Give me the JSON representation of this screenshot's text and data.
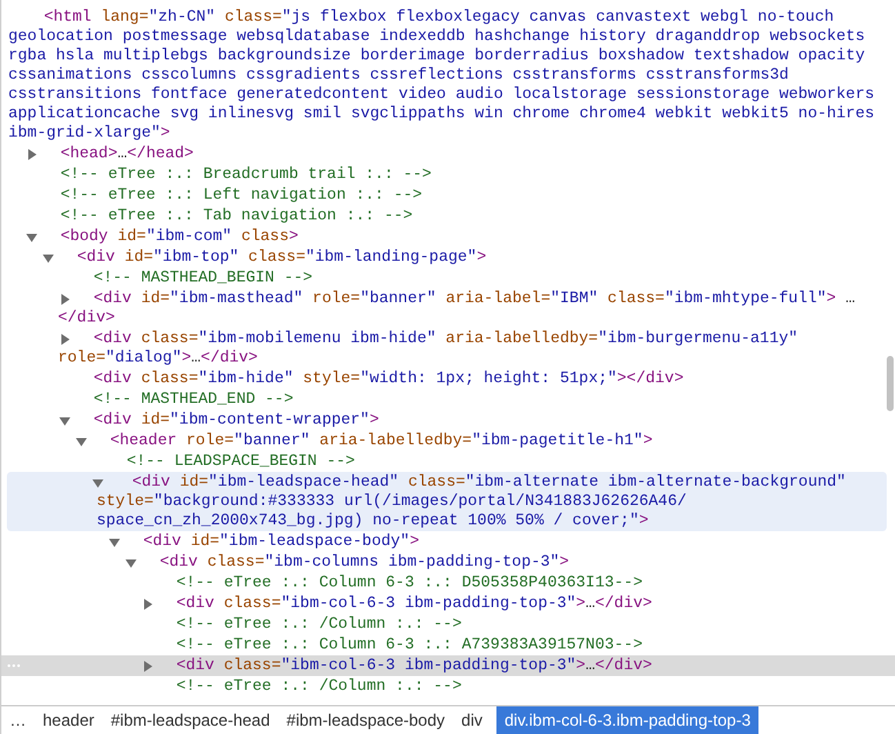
{
  "elements_tree": {
    "hovered": false,
    "selected": false,
    "tokens": [
      {
        "kind": "tag",
        "text": "<html"
      },
      {
        "kind": "attr",
        "text": " lang="
      },
      {
        "kind": "value",
        "text": "\"zh-CN\""
      },
      {
        "kind": "attr",
        "text": " class="
      },
      {
        "kind": "value",
        "text": "\"js flexbox flexboxlegacy canvas canvastext webgl no-touch geolocation postmessage websqldatabase indexeddb hashchange history draganddrop websockets rgba hsla multiplebgs backgroundsize borderimage borderradius boxshadow textshadow opacity cssanimations csscolumns cssgradients cssreflections csstransforms csstransforms3d csstransitions fontface generatedcontent video audio localstorage sessionstorage webworkers applicationcache svg inlinesvg smil svgclippaths win chrome chrome4 webkit webkit5 no-hires ibm-grid-xlarge\""
      },
      {
        "kind": "tag",
        "text": ">"
      }
    ],
    "children": [
      {
        "expanded": false,
        "hovered": false,
        "selected": false,
        "tokens": [
          {
            "kind": "tag",
            "text": "<head>"
          },
          {
            "kind": "text",
            "text": "…"
          },
          {
            "kind": "tag",
            "text": "</head>"
          }
        ]
      },
      {
        "hovered": false,
        "selected": false,
        "tokens": [
          {
            "kind": "comment",
            "text": "<!-- eTree :.: Breadcrumb trail :.: -->"
          }
        ]
      },
      {
        "hovered": false,
        "selected": false,
        "tokens": [
          {
            "kind": "comment",
            "text": "<!-- eTree :.: Left navigation :.: -->"
          }
        ]
      },
      {
        "hovered": false,
        "selected": false,
        "tokens": [
          {
            "kind": "comment",
            "text": "<!-- eTree :.: Tab navigation :.: -->"
          }
        ]
      },
      {
        "expanded": true,
        "hovered": false,
        "selected": false,
        "tokens": [
          {
            "kind": "tag",
            "text": "<body"
          },
          {
            "kind": "attr",
            "text": " id="
          },
          {
            "kind": "value",
            "text": "\"ibm-com\""
          },
          {
            "kind": "attr",
            "text": " class"
          },
          {
            "kind": "tag",
            "text": ">"
          }
        ],
        "children": [
          {
            "expanded": true,
            "hovered": false,
            "selected": false,
            "tokens": [
              {
                "kind": "tag",
                "text": "<div"
              },
              {
                "kind": "attr",
                "text": " id="
              },
              {
                "kind": "value",
                "text": "\"ibm-top\""
              },
              {
                "kind": "attr",
                "text": " class="
              },
              {
                "kind": "value",
                "text": "\"ibm-landing-page\""
              },
              {
                "kind": "tag",
                "text": ">"
              }
            ],
            "children": [
              {
                "hovered": false,
                "selected": false,
                "tokens": [
                  {
                    "kind": "comment",
                    "text": "<!-- MASTHEAD_BEGIN -->"
                  }
                ]
              },
              {
                "expanded": false,
                "hovered": false,
                "selected": false,
                "tokens": [
                  {
                    "kind": "tag",
                    "text": "<div"
                  },
                  {
                    "kind": "attr",
                    "text": " id="
                  },
                  {
                    "kind": "value",
                    "text": "\"ibm-masthead\""
                  },
                  {
                    "kind": "attr",
                    "text": " role="
                  },
                  {
                    "kind": "value",
                    "text": "\"banner\""
                  },
                  {
                    "kind": "attr",
                    "text": " aria-label="
                  },
                  {
                    "kind": "value",
                    "text": "\"IBM\""
                  },
                  {
                    "kind": "attr",
                    "text": " class="
                  },
                  {
                    "kind": "value",
                    "text": "\"ibm-mhtype-full\""
                  },
                  {
                    "kind": "tag",
                    "text": ">"
                  },
                  {
                    "kind": "text",
                    "text": " …"
                  },
                  {
                    "kind": "tag",
                    "text": "</div>"
                  }
                ]
              },
              {
                "expanded": false,
                "hovered": false,
                "selected": false,
                "tokens": [
                  {
                    "kind": "tag",
                    "text": "<div"
                  },
                  {
                    "kind": "attr",
                    "text": " class="
                  },
                  {
                    "kind": "value",
                    "text": "\"ibm-mobilemenu ibm-hide\""
                  },
                  {
                    "kind": "attr",
                    "text": " aria-labelledby="
                  },
                  {
                    "kind": "value",
                    "text": "\"ibm-burgermenu-a11y\""
                  },
                  {
                    "kind": "attr",
                    "text": " role="
                  },
                  {
                    "kind": "value",
                    "text": "\"dialog\""
                  },
                  {
                    "kind": "tag",
                    "text": ">"
                  },
                  {
                    "kind": "text",
                    "text": "…"
                  },
                  {
                    "kind": "tag",
                    "text": "</div>"
                  }
                ]
              },
              {
                "hovered": false,
                "selected": false,
                "tokens": [
                  {
                    "kind": "tag",
                    "text": "<div"
                  },
                  {
                    "kind": "attr",
                    "text": " class="
                  },
                  {
                    "kind": "value",
                    "text": "\"ibm-hide\""
                  },
                  {
                    "kind": "attr",
                    "text": " style="
                  },
                  {
                    "kind": "value",
                    "text": "\"width: 1px; height: 51px;\""
                  },
                  {
                    "kind": "tag",
                    "text": "></div>"
                  }
                ]
              },
              {
                "hovered": false,
                "selected": false,
                "tokens": [
                  {
                    "kind": "comment",
                    "text": "<!-- MASTHEAD_END -->"
                  }
                ]
              },
              {
                "expanded": true,
                "hovered": false,
                "selected": false,
                "tokens": [
                  {
                    "kind": "tag",
                    "text": "<div"
                  },
                  {
                    "kind": "attr",
                    "text": " id="
                  },
                  {
                    "kind": "value",
                    "text": "\"ibm-content-wrapper\""
                  },
                  {
                    "kind": "tag",
                    "text": ">"
                  }
                ],
                "children": [
                  {
                    "expanded": true,
                    "hovered": false,
                    "selected": false,
                    "tokens": [
                      {
                        "kind": "tag",
                        "text": "<header"
                      },
                      {
                        "kind": "attr",
                        "text": " role="
                      },
                      {
                        "kind": "value",
                        "text": "\"banner\""
                      },
                      {
                        "kind": "attr",
                        "text": " aria-labelledby="
                      },
                      {
                        "kind": "value",
                        "text": "\"ibm-pagetitle-h1\""
                      },
                      {
                        "kind": "tag",
                        "text": ">"
                      }
                    ],
                    "children": [
                      {
                        "hovered": false,
                        "selected": false,
                        "tokens": [
                          {
                            "kind": "comment",
                            "text": "<!-- LEADSPACE_BEGIN -->"
                          }
                        ]
                      },
                      {
                        "expanded": true,
                        "hovered": true,
                        "selected": false,
                        "tokens": [
                          {
                            "kind": "tag",
                            "text": "<div"
                          },
                          {
                            "kind": "attr",
                            "text": " id="
                          },
                          {
                            "kind": "value",
                            "text": "\"ibm-leadspace-head\""
                          },
                          {
                            "kind": "attr",
                            "text": " class="
                          },
                          {
                            "kind": "value",
                            "text": "\"ibm-alternate ibm-alternate-background\""
                          },
                          {
                            "kind": "attr",
                            "text": " style="
                          },
                          {
                            "kind": "value",
                            "text": "\"background:#333333 url(/images/portal/N341883J62626A46/ space_cn_zh_2000x743_bg.jpg) no-repeat 100% 50% / cover;\""
                          },
                          {
                            "kind": "tag",
                            "text": ">"
                          }
                        ],
                        "children": [
                          {
                            "expanded": true,
                            "hovered": false,
                            "selected": false,
                            "tokens": [
                              {
                                "kind": "tag",
                                "text": "<div"
                              },
                              {
                                "kind": "attr",
                                "text": " id="
                              },
                              {
                                "kind": "value",
                                "text": "\"ibm-leadspace-body\""
                              },
                              {
                                "kind": "tag",
                                "text": ">"
                              }
                            ],
                            "children": [
                              {
                                "expanded": true,
                                "hovered": false,
                                "selected": false,
                                "tokens": [
                                  {
                                    "kind": "tag",
                                    "text": "<div"
                                  },
                                  {
                                    "kind": "attr",
                                    "text": " class="
                                  },
                                  {
                                    "kind": "value",
                                    "text": "\"ibm-columns ibm-padding-top-3\""
                                  },
                                  {
                                    "kind": "tag",
                                    "text": ">"
                                  }
                                ],
                                "children": [
                                  {
                                    "hovered": false,
                                    "selected": false,
                                    "tokens": [
                                      {
                                        "kind": "comment",
                                        "text": "<!-- eTree :.: Column 6-3 :.: D505358P40363I13-->"
                                      }
                                    ]
                                  },
                                  {
                                    "expanded": false,
                                    "hovered": false,
                                    "selected": false,
                                    "tokens": [
                                      {
                                        "kind": "tag",
                                        "text": "<div"
                                      },
                                      {
                                        "kind": "attr",
                                        "text": " class="
                                      },
                                      {
                                        "kind": "value",
                                        "text": "\"ibm-col-6-3 ibm-padding-top-3\""
                                      },
                                      {
                                        "kind": "tag",
                                        "text": ">"
                                      },
                                      {
                                        "kind": "text",
                                        "text": "…"
                                      },
                                      {
                                        "kind": "tag",
                                        "text": "</div>"
                                      }
                                    ]
                                  },
                                  {
                                    "hovered": false,
                                    "selected": false,
                                    "tokens": [
                                      {
                                        "kind": "comment",
                                        "text": "<!-- eTree :.: /Column :.: -->"
                                      }
                                    ]
                                  },
                                  {
                                    "hovered": false,
                                    "selected": false,
                                    "tokens": [
                                      {
                                        "kind": "comment",
                                        "text": "<!-- eTree :.: Column 6-3 :.: A739383A39157N03-->"
                                      }
                                    ]
                                  },
                                  {
                                    "expanded": false,
                                    "hovered": false,
                                    "selected": true,
                                    "tokens": [
                                      {
                                        "kind": "tag",
                                        "text": "<div"
                                      },
                                      {
                                        "kind": "attr",
                                        "text": " class="
                                      },
                                      {
                                        "kind": "value",
                                        "text": "\"ibm-col-6-3 ibm-padding-top-3\""
                                      },
                                      {
                                        "kind": "tag",
                                        "text": ">"
                                      },
                                      {
                                        "kind": "text",
                                        "text": "…"
                                      },
                                      {
                                        "kind": "tag",
                                        "text": "</div>"
                                      }
                                    ]
                                  },
                                  {
                                    "hovered": false,
                                    "selected": false,
                                    "tokens": [
                                      {
                                        "kind": "comment",
                                        "text": "<!-- eTree :.: /Column :.: -->"
                                      }
                                    ]
                                  }
                                ]
                              }
                            ]
                          }
                        ]
                      }
                    ]
                  }
                ]
              }
            ]
          }
        ]
      }
    ]
  },
  "breadcrumb": [
    {
      "label": "…",
      "selected": false
    },
    {
      "label": "header",
      "selected": false
    },
    {
      "label": "#ibm-leadspace-head",
      "selected": false
    },
    {
      "label": "#ibm-leadspace-body",
      "selected": false
    },
    {
      "label": "div",
      "selected": false
    },
    {
      "label": "div.ibm-col-6-3.ibm-padding-top-3",
      "selected": true
    }
  ]
}
